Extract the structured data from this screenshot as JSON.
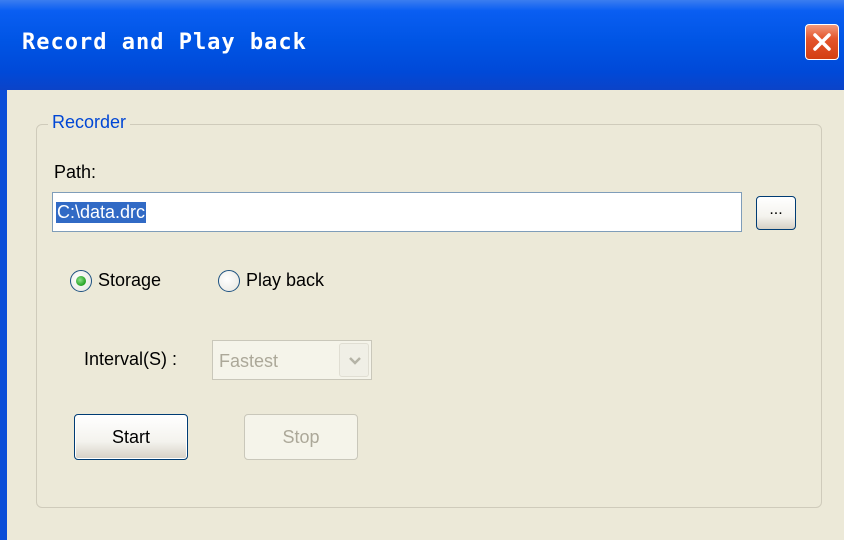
{
  "window": {
    "title": "Record and Play back",
    "close_icon": "close-icon"
  },
  "recorder": {
    "group_label": "Recorder",
    "path_label": "Path:",
    "path_value": "C:\\data.drc",
    "browse_label": "...",
    "radio_storage_label": "Storage",
    "radio_storage_selected": true,
    "radio_playback_label": "Play back",
    "radio_playback_selected": false,
    "interval_label": "Interval(S) :",
    "interval_value": "Fastest",
    "interval_enabled": false,
    "start_label": "Start",
    "stop_label": "Stop",
    "stop_enabled": false
  },
  "colors": {
    "titlebar": "#0055e5",
    "dialog_bg": "#ece9d8",
    "group_label": "#0046d5",
    "selection": "#316ac5",
    "close_button": "#e4552c",
    "radio_dot": "#21a121",
    "disabled_text": "#aca899"
  }
}
